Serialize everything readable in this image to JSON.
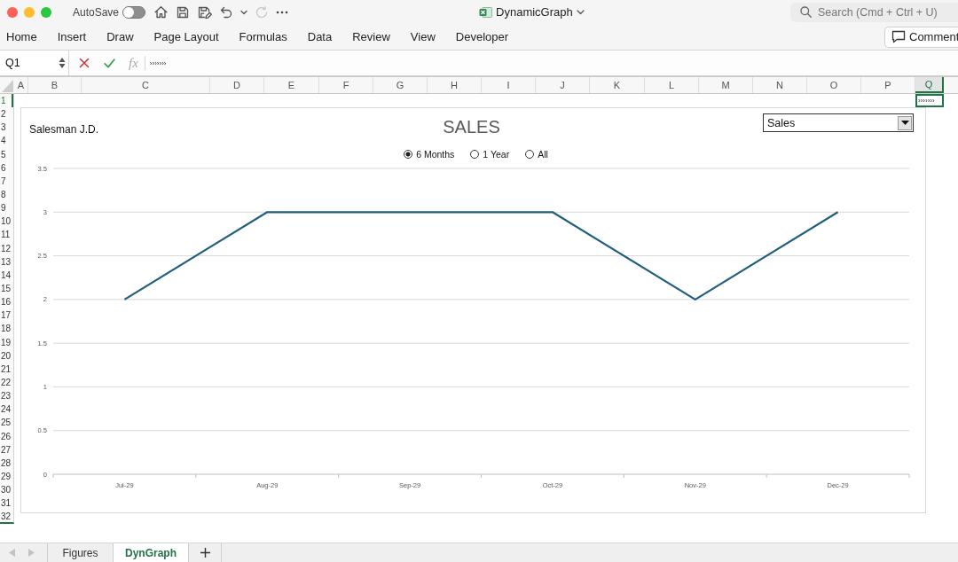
{
  "window": {
    "autosave": {
      "label": "AutoSave",
      "on": false
    },
    "redo": {
      "disabled": true
    },
    "title": "DynamicGraph",
    "search": {
      "placeholder": "Search (Cmd + Ctrl + U)"
    }
  },
  "ribbon": {
    "tabs": [
      {
        "label": "Home"
      },
      {
        "label": "Insert"
      },
      {
        "label": "Draw"
      },
      {
        "label": "Page Layout"
      },
      {
        "label": "Formulas"
      },
      {
        "label": "Data"
      },
      {
        "label": "Review"
      },
      {
        "label": "View"
      },
      {
        "label": "Developer"
      }
    ],
    "comments_button": {
      "label": "Comment"
    }
  },
  "formula_bar": {
    "name_box": "Q1",
    "function_button": "fx",
    "content": "›››››››"
  },
  "sheet": {
    "columns": [
      {
        "label": "A",
        "selected": false
      },
      {
        "label": "B",
        "selected": false
      },
      {
        "label": "C",
        "selected": false
      },
      {
        "label": "D",
        "selected": false
      },
      {
        "label": "E",
        "selected": false
      },
      {
        "label": "F",
        "selected": false
      },
      {
        "label": "G",
        "selected": false
      },
      {
        "label": "H",
        "selected": false
      },
      {
        "label": "I",
        "selected": false
      },
      {
        "label": "J",
        "selected": false
      },
      {
        "label": "K",
        "selected": false
      },
      {
        "label": "L",
        "selected": false
      },
      {
        "label": "M",
        "selected": false
      },
      {
        "label": "N",
        "selected": false
      },
      {
        "label": "O",
        "selected": false
      },
      {
        "label": "P",
        "selected": false
      },
      {
        "label": "Q",
        "selected": true
      }
    ],
    "rows": [
      {
        "label": "1",
        "selected": true
      },
      {
        "label": "2",
        "selected": false
      },
      {
        "label": "3",
        "selected": false
      },
      {
        "label": "4",
        "selected": false
      },
      {
        "label": "5",
        "selected": false
      },
      {
        "label": "6",
        "selected": false
      },
      {
        "label": "7",
        "selected": false
      },
      {
        "label": "8",
        "selected": false
      },
      {
        "label": "9",
        "selected": false
      },
      {
        "label": "10",
        "selected": false
      },
      {
        "label": "11",
        "selected": false
      },
      {
        "label": "12",
        "selected": false
      },
      {
        "label": "13",
        "selected": false
      },
      {
        "label": "14",
        "selected": false
      },
      {
        "label": "15",
        "selected": false
      },
      {
        "label": "16",
        "selected": false
      },
      {
        "label": "17",
        "selected": false
      },
      {
        "label": "18",
        "selected": false
      },
      {
        "label": "19",
        "selected": false
      },
      {
        "label": "20",
        "selected": false
      },
      {
        "label": "21",
        "selected": false
      },
      {
        "label": "22",
        "selected": false
      },
      {
        "label": "23",
        "selected": false
      },
      {
        "label": "24",
        "selected": false
      },
      {
        "label": "25",
        "selected": false
      },
      {
        "label": "26",
        "selected": false
      },
      {
        "label": "27",
        "selected": false
      },
      {
        "label": "28",
        "selected": false
      },
      {
        "label": "29",
        "selected": false
      },
      {
        "label": "30",
        "selected": false
      },
      {
        "label": "31",
        "selected": false
      },
      {
        "label": "32",
        "selected": false
      }
    ],
    "active_cell": {
      "value": "›››››››"
    },
    "chart_panel": {
      "salesman_label": "Salesman J.D.",
      "metric_dropdown": {
        "value": "Sales"
      },
      "period_options": [
        {
          "label": "6 Months",
          "selected": true
        },
        {
          "label": "1 Year",
          "selected": false
        },
        {
          "label": "All",
          "selected": false
        }
      ],
      "chart_data": {
        "type": "line",
        "title": "SALES",
        "categories": [
          "Jul-29",
          "Aug-29",
          "Sep-29",
          "Oct-29",
          "Nov-29",
          "Dec-29"
        ],
        "values": [
          2,
          3,
          3,
          3,
          2,
          3
        ],
        "ylim": [
          0,
          3.5
        ],
        "yticks": [
          0,
          0.5,
          1,
          1.5,
          2,
          2.5,
          3,
          3.5
        ],
        "grid": true
      }
    }
  },
  "sheet_tabs": [
    {
      "label": "Figures",
      "selected": false
    },
    {
      "label": "DynGraph",
      "selected": true
    }
  ]
}
